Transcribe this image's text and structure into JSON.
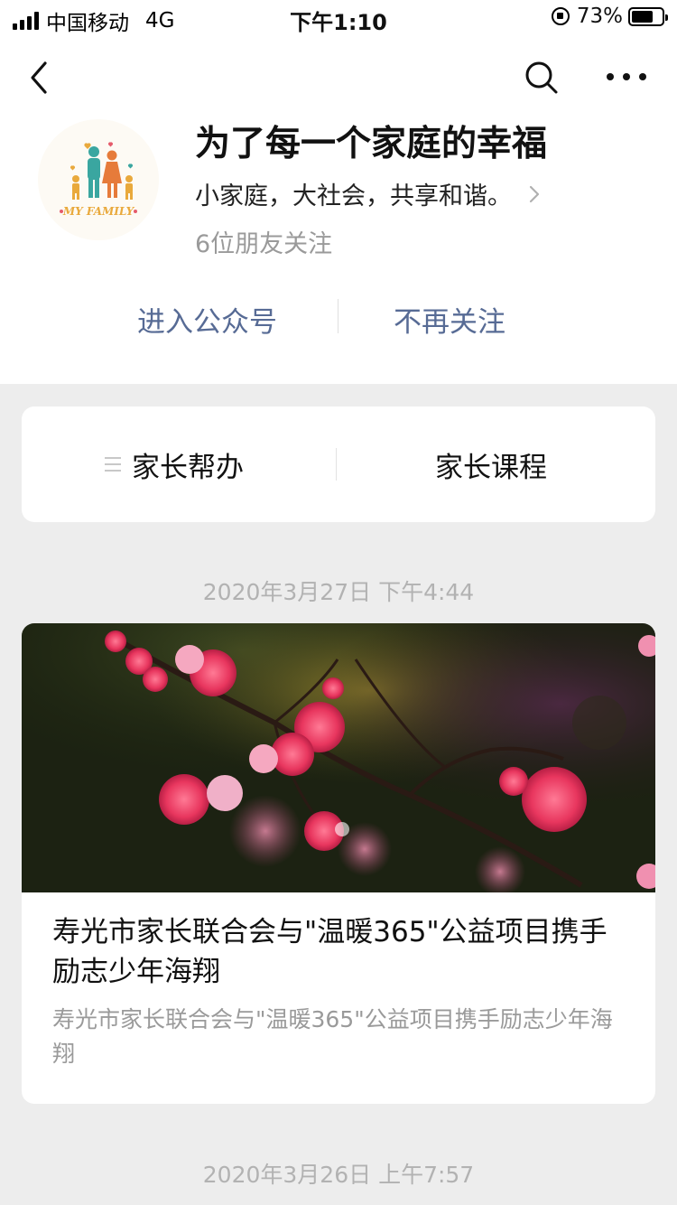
{
  "status_bar": {
    "carrier": "中国移动",
    "network": "4G",
    "time": "下午1:10",
    "battery": "73%",
    "battery_level": 0.73
  },
  "account": {
    "name": "为了每一个家庭的幸福",
    "description": "小家庭，大社会，共享和谐。",
    "followers": "6位朋友关注",
    "avatar_text": "MY FAMILY"
  },
  "actions": {
    "enter": "进入公众号",
    "unfollow": "不再关注"
  },
  "menu": {
    "items": [
      "家长帮办",
      "家长课程"
    ]
  },
  "feed": [
    {
      "date": "2020年3月27日 下午4:44",
      "title": "寿光市家长联合会与\"温暖365\"公益项目携手励志少年海翔",
      "digest": "寿光市家长联合会与\"温暖365\"公益项目携手励志少年海翔"
    },
    {
      "date": "2020年3月26日 上午7:57"
    }
  ],
  "colors": {
    "link": "#576b95",
    "background": "#ededed",
    "card": "#ffffff",
    "muted": "#9a9a9a"
  },
  "icons": [
    "back-arrow-icon",
    "search-icon",
    "more-icon",
    "chevron-right-icon",
    "menu-lines-icon"
  ]
}
